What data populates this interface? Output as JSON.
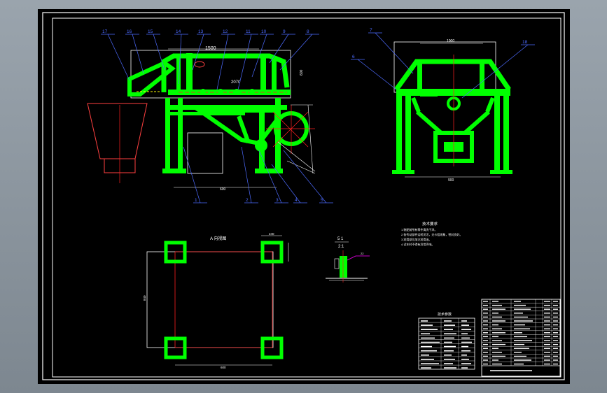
{
  "colors": {
    "background": "#000000",
    "frame": "#ffffff",
    "structure": "#00ff00",
    "centerline": "#ff2020",
    "leader": "#4d6bff",
    "dimension": "#ffffff",
    "accent": "#ff00ff"
  },
  "front_view": {
    "dim_top": "1500",
    "dim_mid": "2070",
    "dim_bottom": "600",
    "dim_right": "600",
    "callouts": [
      "17",
      "16",
      "15",
      "14",
      "13",
      "12",
      "11",
      "10",
      "9",
      "8",
      "1",
      "2",
      "3",
      "4",
      "5"
    ]
  },
  "side_view": {
    "dim_top": "1000",
    "dim_bottom": "900",
    "callouts": [
      "7",
      "6",
      "18"
    ]
  },
  "foundation_view": {
    "title": "A 向视图",
    "dim_top": "240",
    "dim_side": "840",
    "dim_bottom": "600"
  },
  "section_view": {
    "label_top": "5 1",
    "label_mid": "2:1",
    "note": "22"
  },
  "technical_requirements": {
    "title": "技术要求",
    "lines": [
      "1.装配前所有零件清洗干净。",
      "2.各传动部件运转灵活，无卡阻现象，密封良好。",
      "3.润滑部位加注润滑油。",
      "4.试车时不得有异常声响。"
    ]
  },
  "param_table": {
    "title": "技术参数"
  }
}
